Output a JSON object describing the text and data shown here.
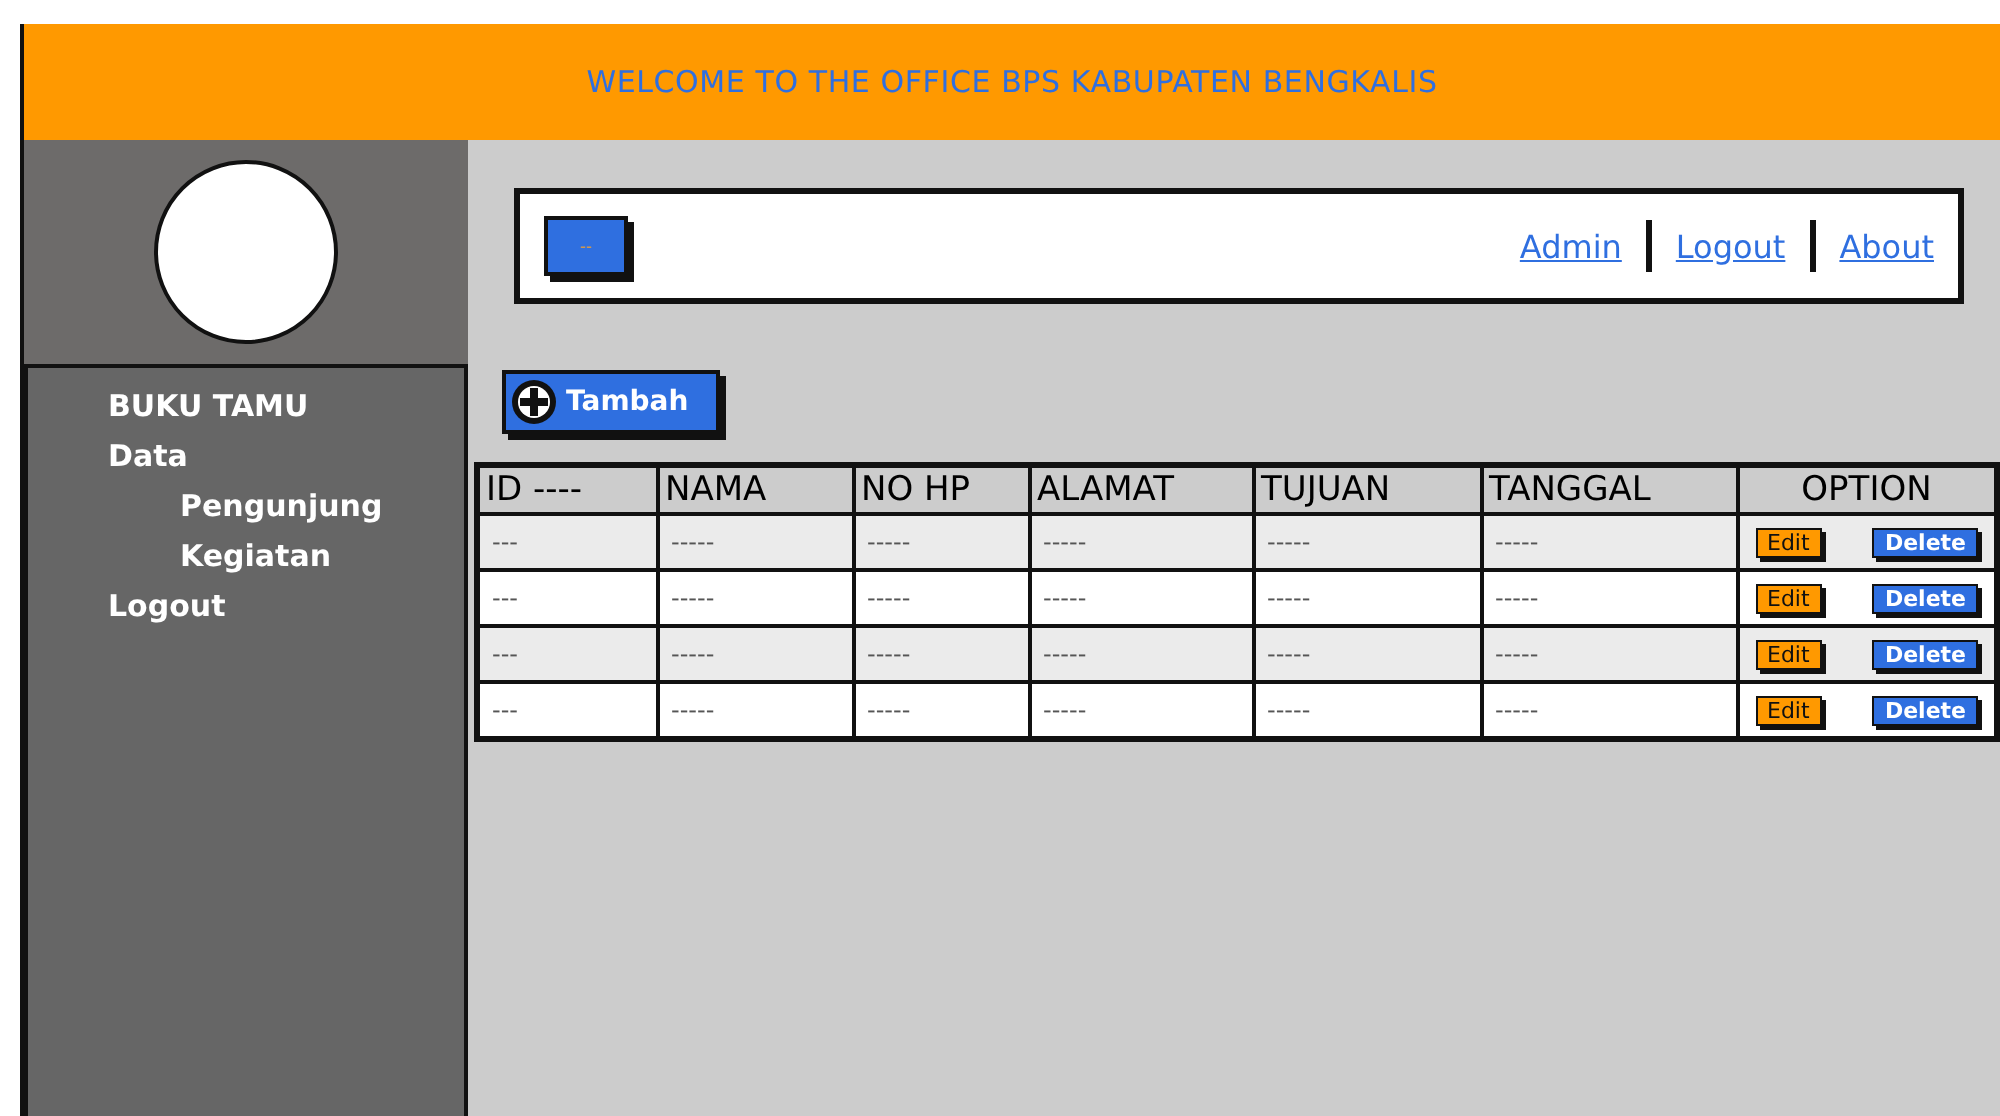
{
  "header": {
    "title": "WELCOME TO THE OFFICE BPS KABUPATEN BENGKALIS"
  },
  "sidebar": {
    "items": [
      {
        "label": "BUKU TAMU"
      },
      {
        "label": "Data",
        "children": [
          {
            "label": "Pengunjung"
          },
          {
            "label": "Kegiatan"
          }
        ]
      },
      {
        "label": "Logout"
      }
    ]
  },
  "topbar": {
    "button_label": "--",
    "links": [
      "Admin",
      "Logout",
      "About"
    ]
  },
  "add_button": "Tambah",
  "table": {
    "columns": [
      "ID ----",
      "NAMA",
      "NO HP",
      "ALAMAT",
      "TUJUAN",
      "TANGGAL",
      "OPTION"
    ],
    "rows": [
      {
        "cells": [
          "---",
          "-----",
          "-----",
          "-----",
          "-----",
          "-----"
        ],
        "edit": "Edit",
        "delete": "Delete"
      },
      {
        "cells": [
          "---",
          "-----",
          "-----",
          "-----",
          "-----",
          "-----"
        ],
        "edit": "Edit",
        "delete": "Delete"
      },
      {
        "cells": [
          "---",
          "-----",
          "-----",
          "-----",
          "-----",
          "-----"
        ],
        "edit": "Edit",
        "delete": "Delete"
      },
      {
        "cells": [
          "---",
          "-----",
          "-----",
          "-----",
          "-----",
          "-----"
        ],
        "edit": "Edit",
        "delete": "Delete"
      }
    ]
  }
}
